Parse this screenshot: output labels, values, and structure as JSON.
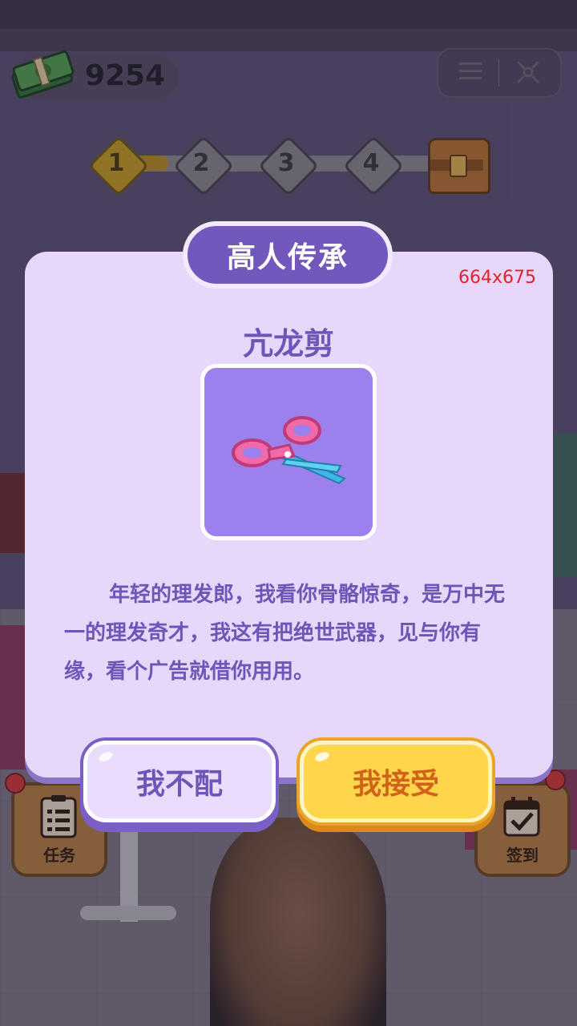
{
  "hud": {
    "cash": "9254",
    "cash_icon": "cash-stack-icon",
    "menu_icon": "menu-icon",
    "close_icon": "close-icon"
  },
  "progress": {
    "steps": [
      "1",
      "2",
      "3",
      "4"
    ],
    "current_step": 1,
    "fill_fraction": 0.15,
    "reward_icon": "treasure-chest-icon"
  },
  "side_buttons": {
    "tasks_label": "任务",
    "checkin_label": "签到"
  },
  "dialog": {
    "title": "高人传承",
    "size_label": "664x675",
    "item_name": "亢龙剪",
    "item_icon": "scissors-icon",
    "description": "年轻的理发郎，我看你骨骼惊奇，是万中无一的理发奇才，我这有把绝世武器，见与你有缘，看个广告就借你用用。",
    "decline_label": "我不配",
    "accept_label": "我接受"
  },
  "colors": {
    "dialog_bg": "#e6d7fb",
    "title_bg": "#7257bd",
    "text_purple": "#6e55b8",
    "accept_bg": "#ffd54a",
    "accept_text": "#d2621a"
  }
}
